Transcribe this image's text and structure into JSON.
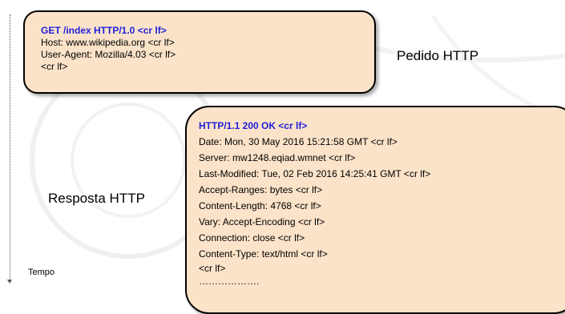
{
  "request": {
    "label": "Pedido HTTP",
    "lines": [
      "GET /index HTTP/1.0  <cr lf>",
      "Host: www.wikipedia.org <cr lf>",
      "User-Agent: Mozilla/4.03 <cr lf>",
      "<cr lf>"
    ]
  },
  "response": {
    "label": "Resposta HTTP",
    "lines": [
      "HTTP/1.1   200  OK   <cr lf>",
      "Date: Mon, 30 May 2016 15:21:58 GMT  <cr lf>",
      "Server: mw1248.eqiad.wmnet <cr lf>",
      "Last-Modified: Tue, 02 Feb 2016 14:25:41 GMT  <cr lf>",
      "Accept-Ranges: bytes  <cr lf>",
      "Content-Length: 4768  <cr lf>",
      "Vary: Accept-Encoding  <cr lf>",
      "Connection: close  <cr lf>",
      "Content-Type: text/html  <cr lf>",
      " <cr lf>",
      "………………."
    ]
  },
  "time_axis": {
    "label": "Tempo"
  },
  "colors": {
    "box_fill": "#fbe3c9",
    "box_border": "#000000",
    "first_line_text": "#1f1fd9",
    "watermark": "#f0f0f0"
  }
}
